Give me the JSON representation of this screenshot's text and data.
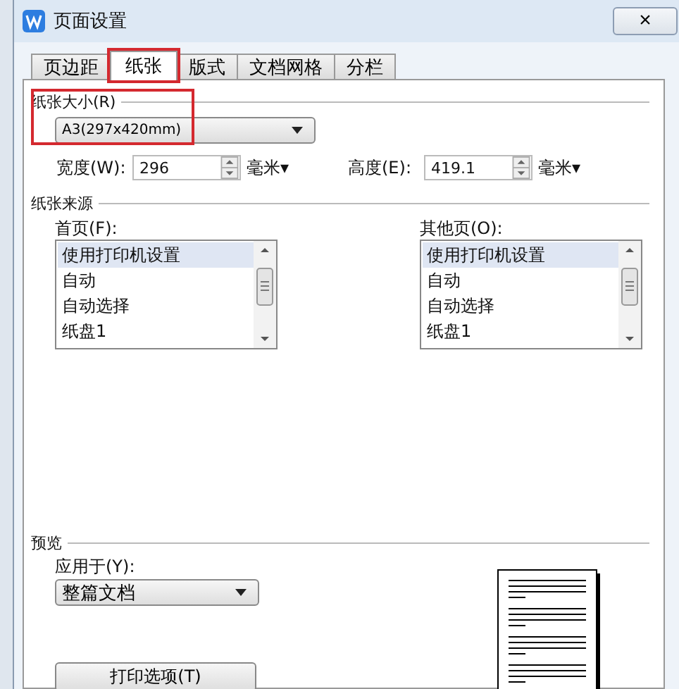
{
  "window": {
    "title": "页面设置",
    "close": "×"
  },
  "tabs": [
    {
      "label": "页边距",
      "selected": false,
      "highlighted": false
    },
    {
      "label": "纸张",
      "selected": true,
      "highlighted": true
    },
    {
      "label": "版式",
      "selected": false,
      "highlighted": false
    },
    {
      "label": "文档网格",
      "selected": false,
      "highlighted": false
    },
    {
      "label": "分栏",
      "selected": false,
      "highlighted": false
    }
  ],
  "paper_size": {
    "title": "纸张大小(R)",
    "highlighted": true,
    "value": "A3(297x420mm)",
    "width": {
      "label": "宽度(W):",
      "value": "296",
      "unit": "毫米▾"
    },
    "height": {
      "label": "高度(E):",
      "value": "419.1",
      "unit": "毫米▾"
    }
  },
  "paper_source": {
    "title": "纸张来源",
    "lists": [
      {
        "label": "首页(F):",
        "items": [
          {
            "text": "使用打印机设置",
            "selected": true
          },
          {
            "text": "自动",
            "selected": false
          },
          {
            "text": "自动选择",
            "selected": false
          },
          {
            "text": "纸盘1",
            "selected": false
          }
        ]
      },
      {
        "label": "其他页(O):",
        "items": [
          {
            "text": "使用打印机设置",
            "selected": true
          },
          {
            "text": "自动",
            "selected": false
          },
          {
            "text": "自动选择",
            "selected": false
          },
          {
            "text": "纸盘1",
            "selected": false
          }
        ]
      }
    ]
  },
  "preview": {
    "title": "预览",
    "apply_label": "应用于(Y):",
    "apply_value": "整篇文档",
    "print_options_button": "打印选项(T)"
  }
}
